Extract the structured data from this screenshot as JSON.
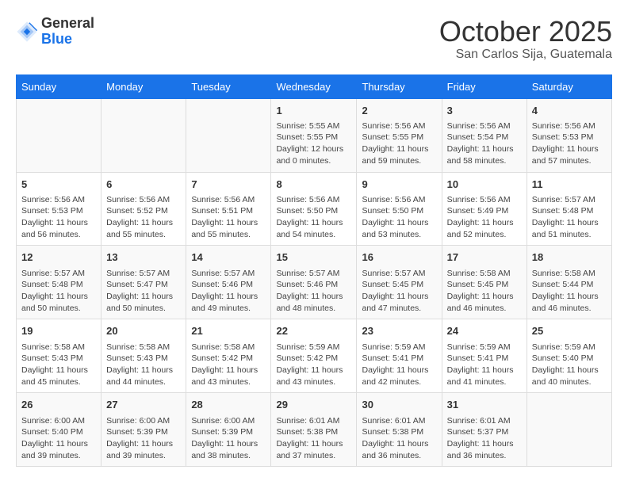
{
  "header": {
    "logo_general": "General",
    "logo_blue": "Blue",
    "month": "October 2025",
    "location": "San Carlos Sija, Guatemala"
  },
  "days_of_week": [
    "Sunday",
    "Monday",
    "Tuesday",
    "Wednesday",
    "Thursday",
    "Friday",
    "Saturday"
  ],
  "weeks": [
    {
      "days": [
        {
          "number": "",
          "info": ""
        },
        {
          "number": "",
          "info": ""
        },
        {
          "number": "",
          "info": ""
        },
        {
          "number": "1",
          "info": "Sunrise: 5:55 AM\nSunset: 5:55 PM\nDaylight: 12 hours\nand 0 minutes."
        },
        {
          "number": "2",
          "info": "Sunrise: 5:56 AM\nSunset: 5:55 PM\nDaylight: 11 hours\nand 59 minutes."
        },
        {
          "number": "3",
          "info": "Sunrise: 5:56 AM\nSunset: 5:54 PM\nDaylight: 11 hours\nand 58 minutes."
        },
        {
          "number": "4",
          "info": "Sunrise: 5:56 AM\nSunset: 5:53 PM\nDaylight: 11 hours\nand 57 minutes."
        }
      ]
    },
    {
      "days": [
        {
          "number": "5",
          "info": "Sunrise: 5:56 AM\nSunset: 5:53 PM\nDaylight: 11 hours\nand 56 minutes."
        },
        {
          "number": "6",
          "info": "Sunrise: 5:56 AM\nSunset: 5:52 PM\nDaylight: 11 hours\nand 55 minutes."
        },
        {
          "number": "7",
          "info": "Sunrise: 5:56 AM\nSunset: 5:51 PM\nDaylight: 11 hours\nand 55 minutes."
        },
        {
          "number": "8",
          "info": "Sunrise: 5:56 AM\nSunset: 5:50 PM\nDaylight: 11 hours\nand 54 minutes."
        },
        {
          "number": "9",
          "info": "Sunrise: 5:56 AM\nSunset: 5:50 PM\nDaylight: 11 hours\nand 53 minutes."
        },
        {
          "number": "10",
          "info": "Sunrise: 5:56 AM\nSunset: 5:49 PM\nDaylight: 11 hours\nand 52 minutes."
        },
        {
          "number": "11",
          "info": "Sunrise: 5:57 AM\nSunset: 5:48 PM\nDaylight: 11 hours\nand 51 minutes."
        }
      ]
    },
    {
      "days": [
        {
          "number": "12",
          "info": "Sunrise: 5:57 AM\nSunset: 5:48 PM\nDaylight: 11 hours\nand 50 minutes."
        },
        {
          "number": "13",
          "info": "Sunrise: 5:57 AM\nSunset: 5:47 PM\nDaylight: 11 hours\nand 50 minutes."
        },
        {
          "number": "14",
          "info": "Sunrise: 5:57 AM\nSunset: 5:46 PM\nDaylight: 11 hours\nand 49 minutes."
        },
        {
          "number": "15",
          "info": "Sunrise: 5:57 AM\nSunset: 5:46 PM\nDaylight: 11 hours\nand 48 minutes."
        },
        {
          "number": "16",
          "info": "Sunrise: 5:57 AM\nSunset: 5:45 PM\nDaylight: 11 hours\nand 47 minutes."
        },
        {
          "number": "17",
          "info": "Sunrise: 5:58 AM\nSunset: 5:45 PM\nDaylight: 11 hours\nand 46 minutes."
        },
        {
          "number": "18",
          "info": "Sunrise: 5:58 AM\nSunset: 5:44 PM\nDaylight: 11 hours\nand 46 minutes."
        }
      ]
    },
    {
      "days": [
        {
          "number": "19",
          "info": "Sunrise: 5:58 AM\nSunset: 5:43 PM\nDaylight: 11 hours\nand 45 minutes."
        },
        {
          "number": "20",
          "info": "Sunrise: 5:58 AM\nSunset: 5:43 PM\nDaylight: 11 hours\nand 44 minutes."
        },
        {
          "number": "21",
          "info": "Sunrise: 5:58 AM\nSunset: 5:42 PM\nDaylight: 11 hours\nand 43 minutes."
        },
        {
          "number": "22",
          "info": "Sunrise: 5:59 AM\nSunset: 5:42 PM\nDaylight: 11 hours\nand 43 minutes."
        },
        {
          "number": "23",
          "info": "Sunrise: 5:59 AM\nSunset: 5:41 PM\nDaylight: 11 hours\nand 42 minutes."
        },
        {
          "number": "24",
          "info": "Sunrise: 5:59 AM\nSunset: 5:41 PM\nDaylight: 11 hours\nand 41 minutes."
        },
        {
          "number": "25",
          "info": "Sunrise: 5:59 AM\nSunset: 5:40 PM\nDaylight: 11 hours\nand 40 minutes."
        }
      ]
    },
    {
      "days": [
        {
          "number": "26",
          "info": "Sunrise: 6:00 AM\nSunset: 5:40 PM\nDaylight: 11 hours\nand 39 minutes."
        },
        {
          "number": "27",
          "info": "Sunrise: 6:00 AM\nSunset: 5:39 PM\nDaylight: 11 hours\nand 39 minutes."
        },
        {
          "number": "28",
          "info": "Sunrise: 6:00 AM\nSunset: 5:39 PM\nDaylight: 11 hours\nand 38 minutes."
        },
        {
          "number": "29",
          "info": "Sunrise: 6:01 AM\nSunset: 5:38 PM\nDaylight: 11 hours\nand 37 minutes."
        },
        {
          "number": "30",
          "info": "Sunrise: 6:01 AM\nSunset: 5:38 PM\nDaylight: 11 hours\nand 36 minutes."
        },
        {
          "number": "31",
          "info": "Sunrise: 6:01 AM\nSunset: 5:37 PM\nDaylight: 11 hours\nand 36 minutes."
        },
        {
          "number": "",
          "info": ""
        }
      ]
    }
  ]
}
